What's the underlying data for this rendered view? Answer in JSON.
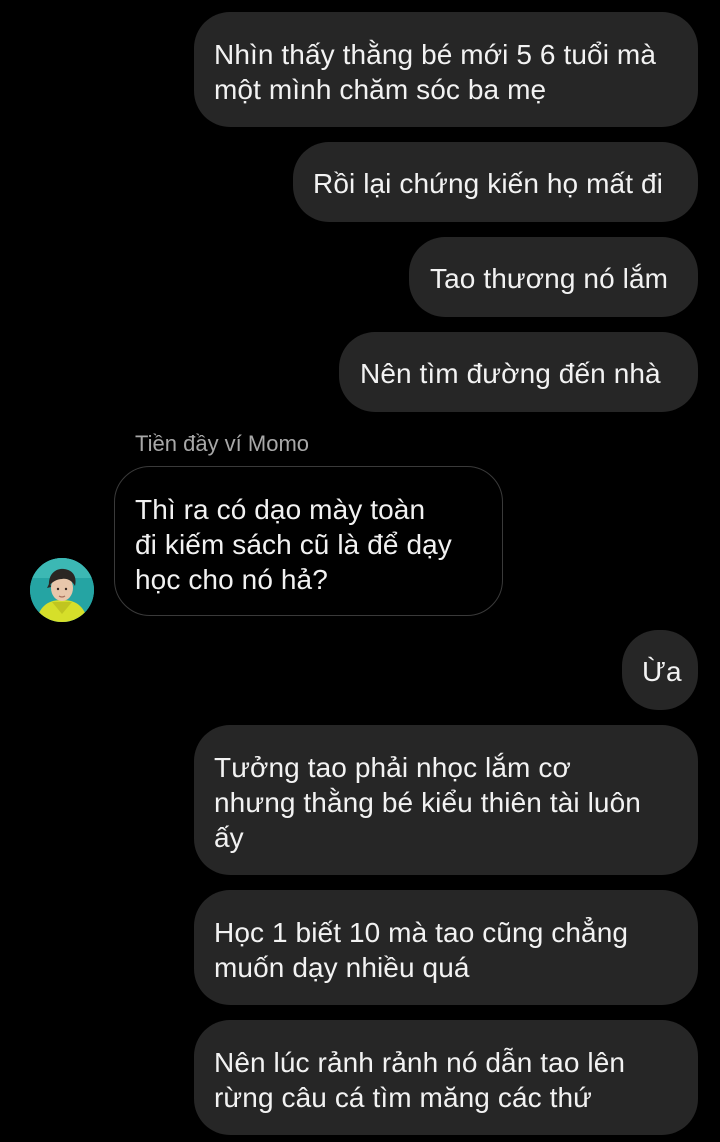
{
  "conversation": {
    "sender_name": "Tiền đầy ví Momo",
    "messages": [
      {
        "direction": "out",
        "lines": [
          "Nhìn thấy thằng bé mới 5 6 tuổi mà",
          "một mình chăm sóc ba mẹ"
        ]
      },
      {
        "direction": "out",
        "lines": [
          "Rồi lại chứng kiến họ mất đi"
        ]
      },
      {
        "direction": "out",
        "lines": [
          "Tao thương nó lắm"
        ]
      },
      {
        "direction": "out",
        "lines": [
          "Nên tìm đường đến nhà"
        ]
      },
      {
        "direction": "in",
        "lines": [
          "Thì ra có dạo mày toàn",
          "đi kiếm sách cũ là để dạy",
          "học cho nó hả?"
        ]
      },
      {
        "direction": "out",
        "lines": [
          "Ừa"
        ]
      },
      {
        "direction": "out",
        "lines": [
          "Tưởng tao phải nhọc lắm cơ",
          "nhưng thằng bé kiểu thiên tài luôn",
          "ấy"
        ]
      },
      {
        "direction": "out",
        "lines": [
          "Học 1 biết 10 mà tao cũng chẳng",
          "muốn dạy nhiều quá"
        ]
      },
      {
        "direction": "out",
        "lines": [
          "Nên lúc rảnh rảnh nó dẫn tao lên",
          "rừng câu cá tìm măng các thứ"
        ]
      }
    ]
  },
  "colors": {
    "background": "#000000",
    "outgoing_bubble": "#262626",
    "incoming_border": "#3a3a3a",
    "text": "#f2f2f2",
    "sender_label": "#a8a8a8"
  },
  "icons": {
    "avatar": "user-avatar-photo"
  }
}
